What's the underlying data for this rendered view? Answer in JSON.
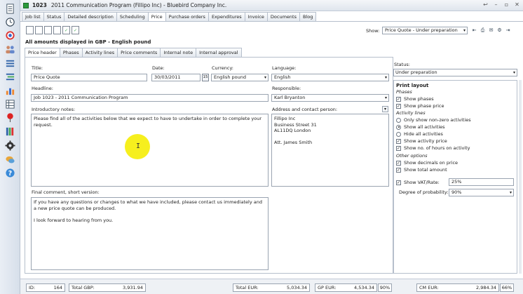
{
  "window": {
    "job_id": "1023",
    "title": "2011 Communication Program (Fillipo Inc)  -  Bluebird Company Inc."
  },
  "main_tabs": [
    {
      "label": "Job list"
    },
    {
      "label": "Status"
    },
    {
      "label": "Detailed description"
    },
    {
      "label": "Scheduling"
    },
    {
      "label": "Price"
    },
    {
      "label": "Purchase orders"
    },
    {
      "label": "Expenditures"
    },
    {
      "label": "Invoice"
    },
    {
      "label": "Documents"
    },
    {
      "label": "Blog"
    }
  ],
  "toolbar": {
    "show_label": "Show:",
    "show_value": "Price Quote - Under preparation"
  },
  "amounts_note": "All amounts displayed in GBP - English pound",
  "sub_tabs": [
    {
      "label": "Price header"
    },
    {
      "label": "Phases"
    },
    {
      "label": "Activity lines"
    },
    {
      "label": "Price comments"
    },
    {
      "label": "Internal note"
    },
    {
      "label": "Internal approval"
    }
  ],
  "form": {
    "title_label": "Title:",
    "title_value": "Price Quote",
    "date_label": "Date:",
    "date_value": "30/03/2011",
    "calendar_btn": "15",
    "currency_label": "Currency:",
    "currency_value": "English pound",
    "language_label": "Language:",
    "language_value": "English",
    "headline_label": "Headline:",
    "headline_value": "Job 1023 - 2011 Communication Program",
    "responsible_label": "Responsible:",
    "responsible_value": "Karl Bryanton",
    "intro_label": "Introductory notes:",
    "intro_value": "Please find all of the activities below that we expect to have to undertake in order to complete your request.",
    "address_label": "Address and contact person:",
    "address_value": "Fillipo Inc\nBusiness Street 31\nAL11DQ London\n\nAtt. James Smith",
    "final_label": "Final comment, short version:",
    "final_value": "If you have any questions or changes to what we have included, please contact us immediately and a new price quote can be produced.\n\nI look forward to hearing from you."
  },
  "status": {
    "label": "Status:",
    "value": "Under preparation"
  },
  "print_layout": {
    "title": "Print layout",
    "group_phases": "Phases",
    "show_phases": "Show phases",
    "show_phase_price": "Show phase price",
    "group_activity": "Activity lines",
    "only_nonzero": "Only show non-zero activities",
    "show_all": "Show all activities",
    "hide_all": "Hide all activities",
    "show_activity_price": "Show activity price",
    "show_hours": "Show no. of hours on activity",
    "group_other": "Other options",
    "show_decimals": "Show decimals on price",
    "show_total": "Show total amount",
    "show_vat": "Show VAT/Rate:",
    "vat_value": "25%",
    "prob_label": "Degree of probability:",
    "prob_value": "90%"
  },
  "footer": {
    "id_label": "ID:",
    "id_value": "164",
    "total_gbp_label": "Total GBP:",
    "total_gbp_value": "3,931.94",
    "total_eur_label": "Total EUR:",
    "total_eur_value": "5,034.34",
    "gp_eur_label": "GP EUR:",
    "gp_eur_value": "4,534.34",
    "gp_pct": "90%",
    "cm_eur_label": "CM EUR:",
    "cm_eur_value": "2,984.34",
    "cm_pct": "66%"
  },
  "icons": {
    "dock": [
      "document-list-icon",
      "clock-icon",
      "target-icon",
      "users-icon",
      "list-icon",
      "tasks-icon",
      "bar-chart-icon",
      "pin-icon",
      "books-icon",
      "gear-icon",
      "chat-icon",
      "help-icon"
    ],
    "check_mark": "✓",
    "dropdown_arrow": "▾"
  }
}
